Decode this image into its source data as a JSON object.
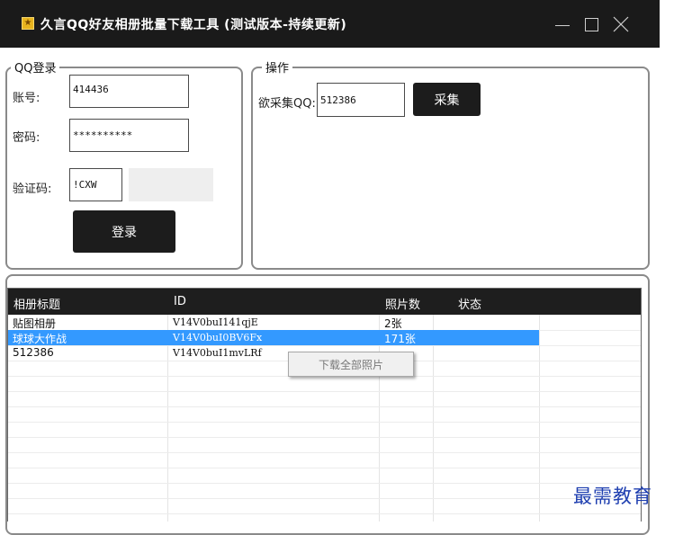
{
  "window": {
    "title": "久言QQ好友相册批量下载工具 (测试版本-持续更新)"
  },
  "login_group": {
    "legend": "QQ登录",
    "account_label": "账号:",
    "account_value": "414436",
    "password_label": "密码:",
    "password_value": "**********",
    "captcha_label": "验证码:",
    "captcha_value": "!CXW",
    "login_button": "登录"
  },
  "operation_group": {
    "legend": "操作",
    "target_label": "欲采集QQ:",
    "target_value": "512386",
    "collect_button": "采集"
  },
  "album_list": {
    "columns": [
      "相册标题",
      "ID",
      "照片数",
      "状态"
    ],
    "rows": [
      {
        "title": "贴图相册",
        "id": "V14V0buI141qjE",
        "count": "2张",
        "status": ""
      },
      {
        "title": "球球大作战",
        "id": "V14V0buI0BV6Fx",
        "count": "171张",
        "status": "",
        "selected": true
      },
      {
        "title": "512386",
        "id": "V14V0buI1mvLRf",
        "count": "",
        "status": ""
      }
    ]
  },
  "context_menu": {
    "items": [
      "下载全部照片"
    ]
  },
  "watermark": "最需教育",
  "colors": {
    "titlebar": "#1a1a1a",
    "header": "#1e1e1e",
    "selection": "#3399ff",
    "watermark": "#1f3fb0"
  }
}
